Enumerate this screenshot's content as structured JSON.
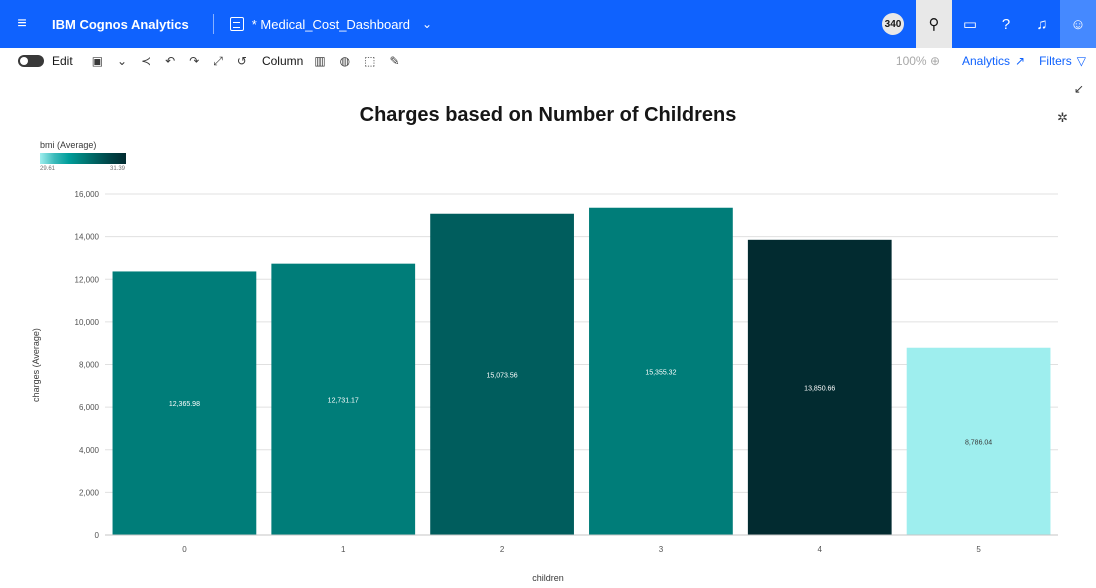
{
  "topbar": {
    "brand": "IBM Cognos Analytics",
    "dashboard_title": "* Medical_Cost_Dashboard",
    "notification_count": "340"
  },
  "toolbar": {
    "edit_label": "Edit",
    "column_label": "Column",
    "zoom_label": "100%",
    "analytics_label": "Analytics",
    "filters_label": "Filters"
  },
  "icons": {
    "menu": "hamburger-icon",
    "dashboard": "dashboard-icon",
    "chevron": "chevron-down-icon",
    "search": "search-icon",
    "chat": "chat-icon",
    "help": "help-icon",
    "bell": "bell-icon",
    "user": "user-icon",
    "save": "save-icon",
    "share": "share-icon",
    "undo": "undo-icon",
    "redo": "redo-icon",
    "expand": "expand-icon",
    "refresh": "refresh-icon",
    "bar-chart": "bar-chart-icon",
    "palette": "palette-icon",
    "select": "select-icon",
    "pin": "pin-icon",
    "zoom": "zoom-icon",
    "analytics": "analytics-icon",
    "filter": "filter-icon",
    "collapse": "collapse-icon",
    "settings": "settings-icon"
  },
  "chart_data": {
    "type": "bar",
    "title": "Charges based on Number of Childrens",
    "xlabel": "children",
    "ylabel": "charges (Average)",
    "categories": [
      "0",
      "1",
      "2",
      "3",
      "4",
      "5"
    ],
    "values": [
      12365.98,
      12731.17,
      15073.56,
      15355.32,
      13850.66,
      8786.04
    ],
    "value_labels": [
      "12,365.98",
      "12,731.17",
      "15,073.56",
      "15,355.32",
      "13,850.66",
      "8,786.04"
    ],
    "bar_colors": [
      "#007d79",
      "#007d79",
      "#005d5d",
      "#007d79",
      "#022b30",
      "#9eeeee"
    ],
    "ylim": [
      0,
      16000
    ],
    "yticks": [
      0,
      2000,
      4000,
      6000,
      8000,
      10000,
      12000,
      14000,
      16000
    ],
    "ytick_labels": [
      "0",
      "2,000",
      "4,000",
      "6,000",
      "8,000",
      "10,000",
      "12,000",
      "14,000",
      "16,000"
    ],
    "grid": true,
    "color_legend": {
      "title": "bmi (Average)",
      "min_label": "29.61",
      "max_label": "31.39"
    }
  }
}
